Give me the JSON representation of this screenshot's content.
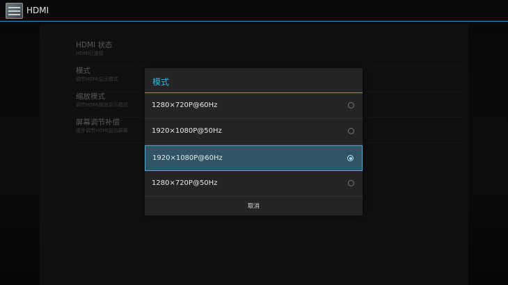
{
  "app": {
    "title": "HDMI",
    "icon": "hdmi-app-icon"
  },
  "settings": [
    {
      "title": "HDMI 状态",
      "subtitle": "HDMI已连接"
    },
    {
      "title": "模式",
      "subtitle": "调节HDMI显示模式"
    },
    {
      "title": "缩放模式",
      "subtitle": "调节HDMI缩放显示模式"
    },
    {
      "title": "屏幕调节补偿",
      "subtitle": "逐步调节HDMI显示屏幕"
    }
  ],
  "dialog": {
    "title": "模式",
    "options": [
      {
        "label": "1280×720P@60Hz",
        "selected": false
      },
      {
        "label": "1920×1080P@50Hz",
        "selected": false
      },
      {
        "label": "1920×1080P@60Hz",
        "selected": true
      },
      {
        "label": "1280×720P@50Hz",
        "selected": false
      }
    ],
    "cancel_label": "取消"
  },
  "colors": {
    "accent": "#35a7da",
    "selected_bg": "#2f5566"
  }
}
